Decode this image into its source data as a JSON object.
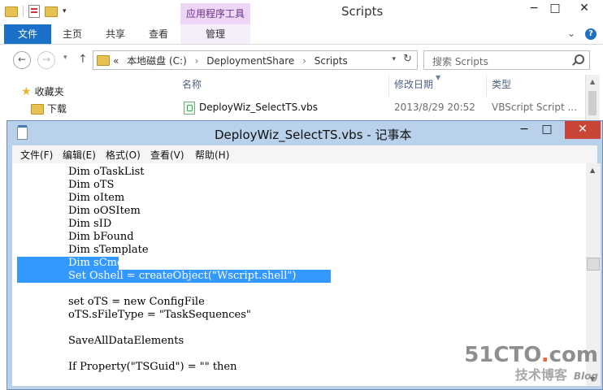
{
  "explorer": {
    "title": "Scripts",
    "contextual_tab": "应用程序工具",
    "ribbon_tabs": [
      "文件",
      "主页",
      "共享",
      "查看",
      "管理"
    ],
    "breadcrumb_prefix": "«",
    "breadcrumbs": [
      "本地磁盘 (C:)",
      "DeploymentShare",
      "Scripts"
    ],
    "search_placeholder": "搜索 Scripts",
    "nav_items": [
      "收藏夹",
      "下载"
    ],
    "columns": [
      "名称",
      "修改日期",
      "类型"
    ],
    "file": {
      "name": "DeployWiz_SelectTS.vbs",
      "modified": "2013/8/29 20:52",
      "type": "VBScript Script ..."
    }
  },
  "notepad": {
    "title": "DeployWiz_SelectTS.vbs - 记事本",
    "menu": [
      "文件(F)",
      "编辑(E)",
      "格式(O)",
      "查看(V)",
      "帮助(H)"
    ],
    "lines": [
      {
        "text": "Dim oTaskList",
        "selected": false
      },
      {
        "text": "Dim oTS",
        "selected": false
      },
      {
        "text": "Dim oItem",
        "selected": false
      },
      {
        "text": "Dim oOSItem",
        "selected": false
      },
      {
        "text": "Dim sID",
        "selected": false
      },
      {
        "text": "Dim bFound",
        "selected": false
      },
      {
        "text": "Dim sTemplate",
        "selected": false
      },
      {
        "text": "Dim sCmd",
        "selected": true
      },
      {
        "text": "Set Oshell = createObject(\"Wscript.shell\")",
        "selected": true
      },
      {
        "text": "",
        "selected": false
      },
      {
        "text": "set oTS = new ConfigFile",
        "selected": false
      },
      {
        "text": "oTS.sFileType = \"TaskSequences\"",
        "selected": false
      },
      {
        "text": "",
        "selected": false
      },
      {
        "text": "SaveAllDataElements",
        "selected": false
      },
      {
        "text": "",
        "selected": false
      },
      {
        "text": "If Property(\"TSGuid\") = \"\" then",
        "selected": false
      }
    ]
  },
  "watermark": {
    "main": "51CTO",
    "dot": ".",
    "suffix": "com",
    "sub": "技术博客",
    "blog": "Blog"
  }
}
